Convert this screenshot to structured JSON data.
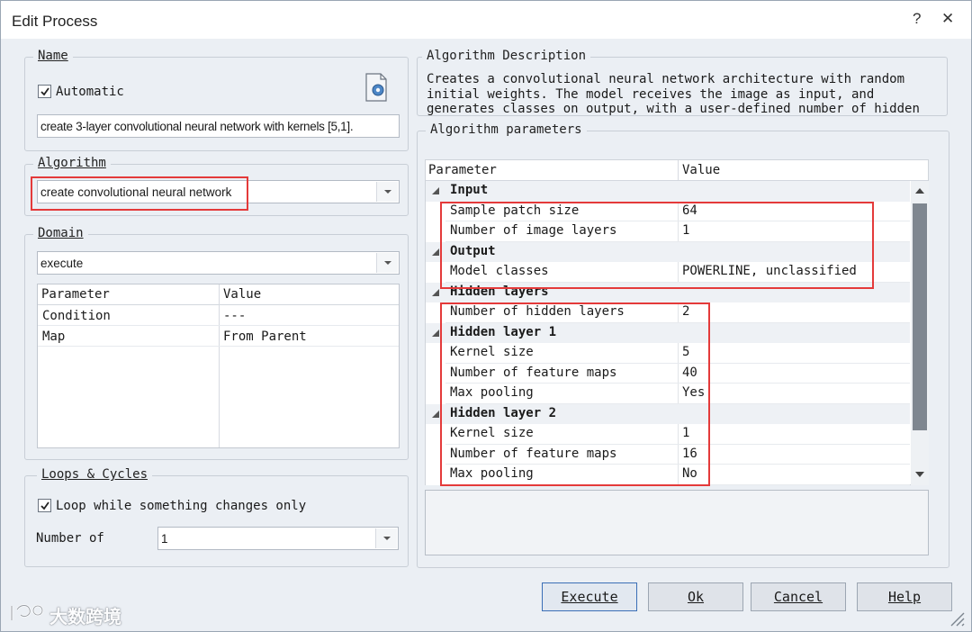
{
  "window": {
    "title": "Edit Process",
    "help_label": "?",
    "close_label": "✕"
  },
  "name_group": {
    "legend": "Name",
    "automatic_label": "Automatic",
    "automatic_checked": true,
    "name_value": "create 3-layer convolutional neural network with kernels [5,1]."
  },
  "algorithm_group": {
    "legend": "Algorithm",
    "selected": "create convolutional neural network"
  },
  "domain_group": {
    "legend": "Domain",
    "selected": "execute",
    "columns": [
      "Parameter",
      "Value"
    ],
    "rows": [
      {
        "param": "Condition",
        "value": "---"
      },
      {
        "param": "Map",
        "value": "From Parent"
      }
    ]
  },
  "loops_group": {
    "legend": "Loops & Cycles",
    "loop_label": "Loop while something changes only",
    "loop_checked": true,
    "number_of_label": "Number of",
    "number_of_value": "1"
  },
  "description_group": {
    "legend": "Algorithm Description",
    "lines": [
      "Creates a convolutional neural network architecture with random",
      "initial weights. The model receives the image as input, and",
      "generates classes on output, with a user-defined number of hidden"
    ]
  },
  "parameters_group": {
    "legend": "Algorithm parameters",
    "columns": [
      "Parameter",
      "Value"
    ],
    "rows": [
      {
        "kind": "category",
        "label": "Input"
      },
      {
        "kind": "param",
        "label": "Sample patch size",
        "value": "64"
      },
      {
        "kind": "param",
        "label": "Number of image layers",
        "value": "1"
      },
      {
        "kind": "category",
        "label": "Output"
      },
      {
        "kind": "param",
        "label": "Model classes",
        "value": "POWERLINE, unclassified"
      },
      {
        "kind": "category",
        "label": "Hidden layers"
      },
      {
        "kind": "param",
        "label": "Number of hidden layers",
        "value": "2"
      },
      {
        "kind": "category",
        "label": "Hidden layer 1"
      },
      {
        "kind": "param",
        "label": "Kernel size",
        "value": "5"
      },
      {
        "kind": "param",
        "label": "Number of feature maps",
        "value": "40"
      },
      {
        "kind": "param",
        "label": "Max pooling",
        "value": "Yes"
      },
      {
        "kind": "category",
        "label": "Hidden layer 2"
      },
      {
        "kind": "param",
        "label": "Kernel size",
        "value": "1"
      },
      {
        "kind": "param",
        "label": "Number of feature maps",
        "value": "16"
      },
      {
        "kind": "param",
        "label": "Max pooling",
        "value": "No"
      }
    ]
  },
  "buttons": {
    "execute": "Execute",
    "ok": "Ok",
    "cancel": "Cancel",
    "help": "Help"
  },
  "watermark": {
    "text": "大数跨境"
  },
  "colors": {
    "highlight": "#e43a3a",
    "dialog_bg": "#ebeff4",
    "primary_border": "#3b6fb6"
  }
}
